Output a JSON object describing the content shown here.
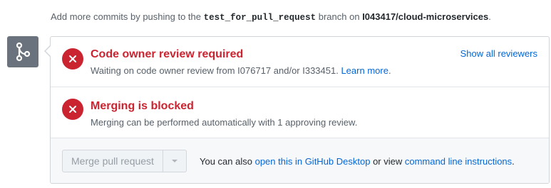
{
  "hint": {
    "prefix": "Add more commits by pushing to the ",
    "branch": "test_for_pull_request",
    "middle": " branch on ",
    "repo": "I043417/cloud-microservices",
    "suffix": "."
  },
  "icons": {
    "merge": "git-merge-icon",
    "error": "x-icon",
    "dropdown": "triangle-down-icon"
  },
  "colors": {
    "error": "#cb2431",
    "link": "#0366d6",
    "icon_bg": "#6a737d"
  },
  "review": {
    "title": "Code owner review required",
    "desc": "Waiting on code owner review from I076717 and/or I333451. ",
    "learn_more": "Learn more",
    "desc_end": ".",
    "show_all": "Show all reviewers"
  },
  "blocked": {
    "title": "Merging is blocked",
    "desc": "Merging can be performed automatically with 1 approving review."
  },
  "merge": {
    "button": "Merge pull request",
    "alt_prefix": "You can also ",
    "desktop_link": "open this in GitHub Desktop",
    "alt_middle": " or view ",
    "cli_link": "command line instructions",
    "alt_suffix": "."
  }
}
